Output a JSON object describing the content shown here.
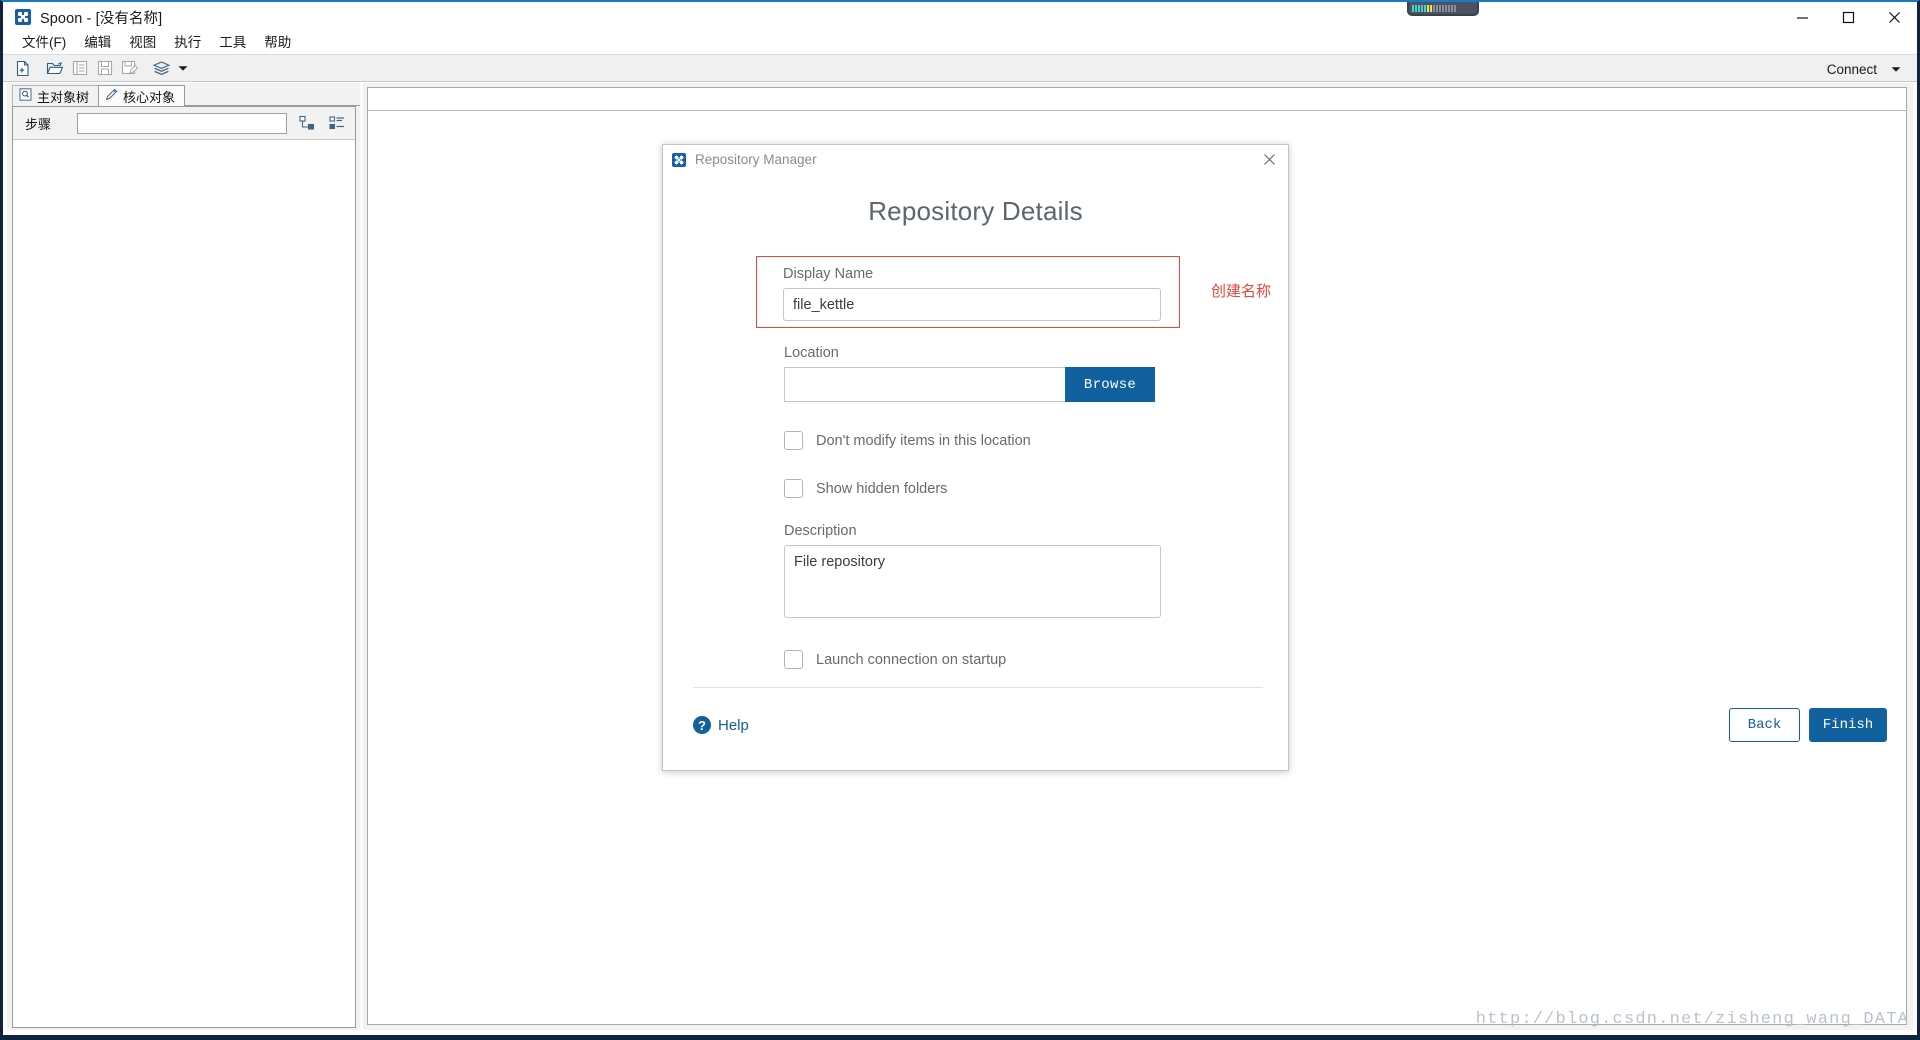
{
  "window": {
    "title": "Spoon - [没有名称]",
    "app_icon": "spoon-icon",
    "controls": {
      "minimize": "minimize-icon",
      "maximize": "maximize-icon",
      "close": "close-icon"
    }
  },
  "menubar": {
    "items": [
      {
        "label": "文件(F)",
        "mnemonic": "F"
      },
      {
        "label": "编辑"
      },
      {
        "label": "视图"
      },
      {
        "label": "执行"
      },
      {
        "label": "工具"
      },
      {
        "label": "帮助"
      }
    ]
  },
  "toolbar": {
    "buttons": [
      {
        "name": "new-file-icon",
        "enabled": true
      },
      {
        "name": "open-folder-icon",
        "enabled": true
      },
      {
        "name": "explore-icon",
        "enabled": false
      },
      {
        "name": "save-icon",
        "enabled": false
      },
      {
        "name": "save-as-icon",
        "enabled": false
      },
      {
        "name": "layers-icon",
        "enabled": true
      }
    ],
    "dropdown_caret": "chevron-down-icon",
    "connect_label": "Connect",
    "connect_caret": "chevron-down-icon"
  },
  "left_panel": {
    "tabs": [
      {
        "label": "主对象树",
        "icon": "document-search-icon",
        "active": false
      },
      {
        "label": "核心对象",
        "icon": "pencil-icon",
        "active": true
      }
    ],
    "steps_label": "步骤",
    "steps_value": "",
    "steps_placeholder": "",
    "tree_icons": [
      "expand-tree-icon",
      "collapse-tree-icon"
    ]
  },
  "dialog": {
    "titlebar": {
      "title": "Repository Manager",
      "icon": "spoon-icon",
      "close": "close-icon"
    },
    "heading": "Repository Details",
    "display_name": {
      "label": "Display Name",
      "value": "file_kettle"
    },
    "location": {
      "label": "Location",
      "value": "",
      "browse_label": "Browse"
    },
    "checkboxes": [
      {
        "label": "Don't modify items in this location",
        "checked": false
      },
      {
        "label": "Show hidden folders",
        "checked": false
      },
      {
        "label": "Launch connection on startup",
        "checked": false
      }
    ],
    "description": {
      "label": "Description",
      "value": "File repository"
    },
    "footer": {
      "help_label": "Help",
      "help_icon": "question-circle-icon",
      "back_label": "Back",
      "finish_label": "Finish"
    }
  },
  "annotation": {
    "note": "创建名称",
    "color": "#e8453c"
  },
  "watermark": {
    "text": "http://blog.csdn.net/zisheng_wang_DATA"
  },
  "colors": {
    "accent_blue": "#11609f",
    "annotation_red": "#e8453c",
    "chrome_gray": "#f0f0f0",
    "frame_navy": "#10223f"
  }
}
